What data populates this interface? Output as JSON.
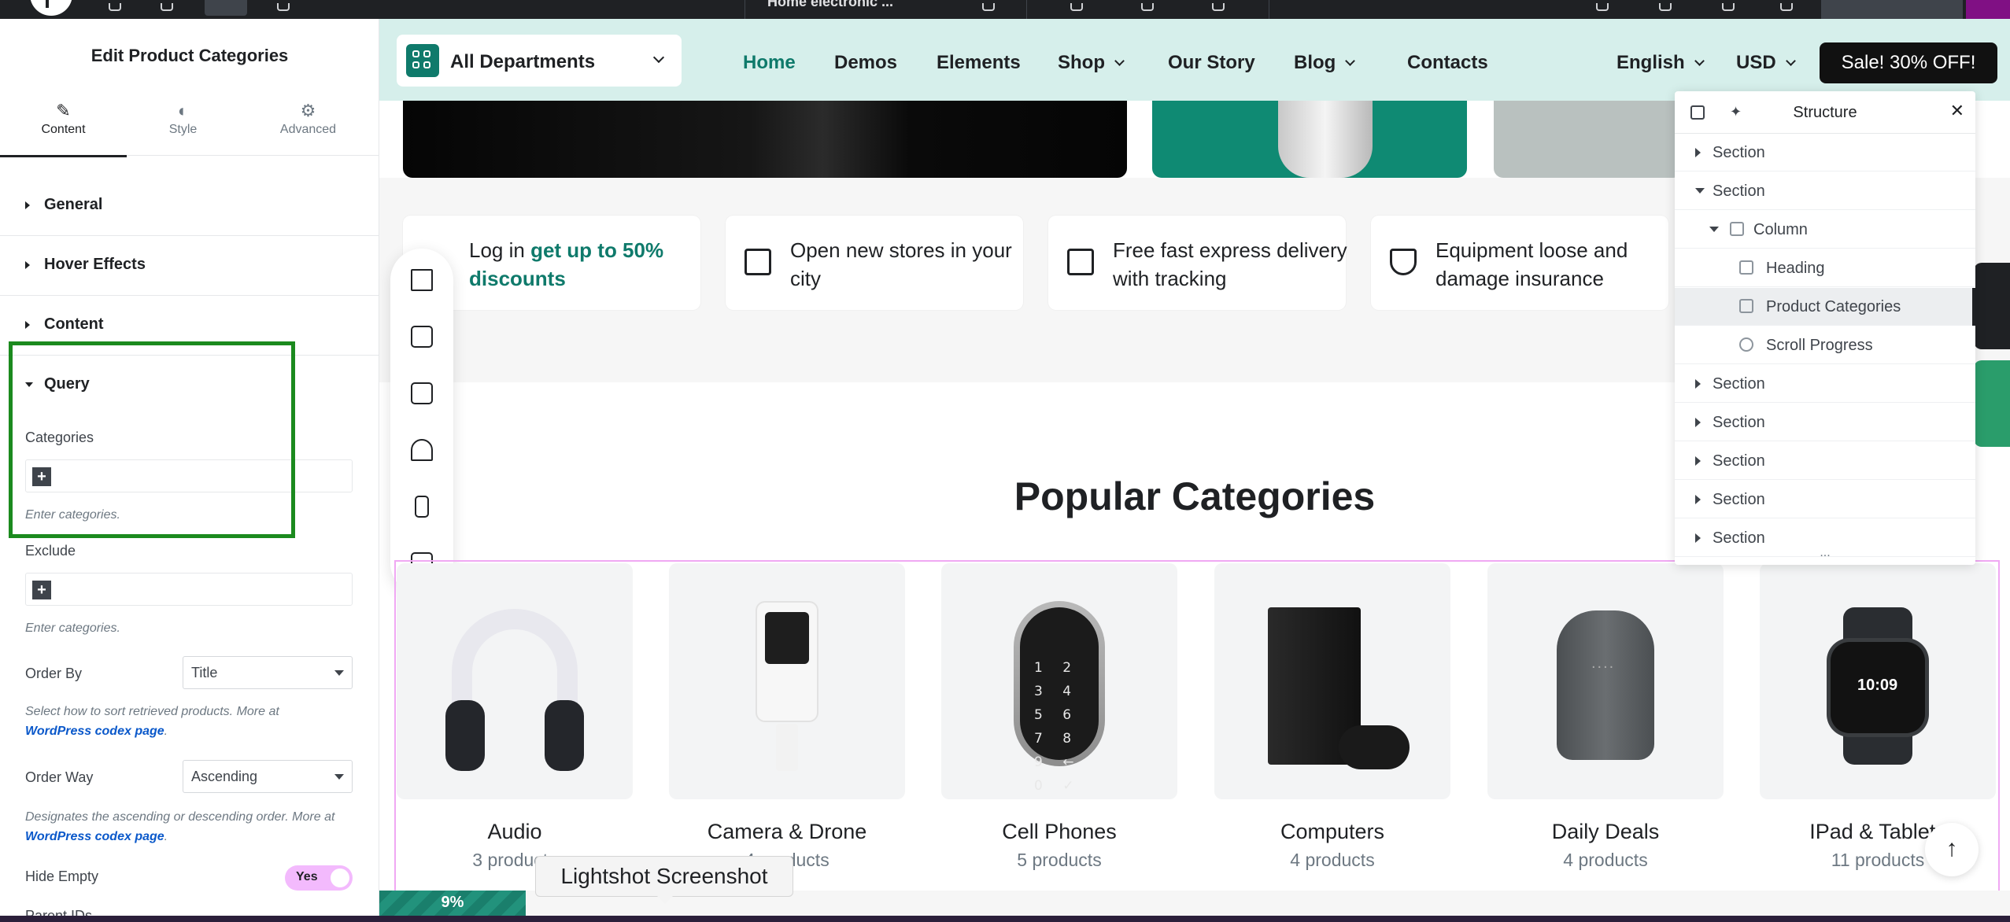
{
  "topbar": {
    "document_title": "Home electronic ..."
  },
  "panel": {
    "title": "Edit Product Categories",
    "tabs": [
      {
        "label": "Content",
        "icon": "pencil-icon"
      },
      {
        "label": "Style",
        "icon": "contrast-icon"
      },
      {
        "label": "Advanced",
        "icon": "gear-icon"
      }
    ],
    "sections": [
      "General",
      "Hover Effects",
      "Content",
      "Query"
    ],
    "query": {
      "categories_label": "Categories",
      "categories_help": "Enter categories.",
      "exclude_label": "Exclude",
      "exclude_help": "Enter categories.",
      "order_by_label": "Order By",
      "order_by_value": "Title",
      "order_by_help": "Select how to sort retrieved products. More at",
      "order_by_link": "WordPress codex page",
      "order_way_label": "Order Way",
      "order_way_value": "Ascending",
      "order_way_help": "Designates the ascending or descending order. More at",
      "order_way_link": "WordPress codex page",
      "hide_empty_label": "Hide Empty",
      "hide_empty_value": "Yes",
      "parent_ids_label": "Parent IDs"
    }
  },
  "header": {
    "departments": "All Departments",
    "nav": [
      "Home",
      "Demos",
      "Elements",
      "Shop",
      "Our Story",
      "Blog",
      "Contacts"
    ],
    "language": "English",
    "currency": "USD",
    "sale_button": "Sale! 30% OFF!"
  },
  "features": [
    {
      "text": "Log in ",
      "highlight": "get up to 50% discounts",
      "icon": "login-icon"
    },
    {
      "text": "Open new stores in your city",
      "highlight": "",
      "icon": "store-icon"
    },
    {
      "text": "Free fast express delivery with tracking",
      "highlight": "",
      "icon": "truck-icon"
    },
    {
      "text": "Equipment loose and damage insurance",
      "highlight": "",
      "icon": "shield-check-icon"
    }
  ],
  "floating_bar_icons": [
    "audio-wave-icon",
    "home-devices-icon",
    "video-camera-icon",
    "camping-icon",
    "phone-icon",
    "speaker-icon"
  ],
  "popular": {
    "title": "Popular Categories",
    "categories": [
      {
        "name": "Audio",
        "count": "3 products"
      },
      {
        "name": "Camera & Drone",
        "count": "4 products"
      },
      {
        "name": "Cell Phones",
        "count": "5 products"
      },
      {
        "name": "Computers",
        "count": "4 products"
      },
      {
        "name": "Daily Deals",
        "count": "4 products"
      },
      {
        "name": "IPad & Tablets",
        "count": "11 products"
      }
    ],
    "lock_keys": "1 2 3 4 5 6 7 8 9 ← 0 ✓",
    "watch_time": "10:09"
  },
  "structure": {
    "title": "Structure",
    "rows": [
      {
        "label": "Section",
        "level": 0,
        "expanded": false
      },
      {
        "label": "Section",
        "level": 0,
        "expanded": true
      },
      {
        "label": "Column",
        "level": 1,
        "expanded": true
      },
      {
        "label": "Heading",
        "level": 2
      },
      {
        "label": "Product Categories",
        "level": 2,
        "selected": true
      },
      {
        "label": "Scroll Progress",
        "level": 2
      },
      {
        "label": "Section",
        "level": 0,
        "expanded": false
      },
      {
        "label": "Section",
        "level": 0,
        "expanded": false
      },
      {
        "label": "Section",
        "level": 0,
        "expanded": false
      },
      {
        "label": "Section",
        "level": 0,
        "expanded": false
      },
      {
        "label": "Section",
        "level": 0,
        "expanded": false
      }
    ],
    "more": "..."
  },
  "progress": {
    "value": 0.09,
    "label": "9%"
  },
  "tooltip": "Lightshot Screenshot",
  "colors": {
    "accent": "#0f7a6b",
    "highlight_box": "#1b8a1e",
    "selection_outline": "#f0a8f3"
  }
}
